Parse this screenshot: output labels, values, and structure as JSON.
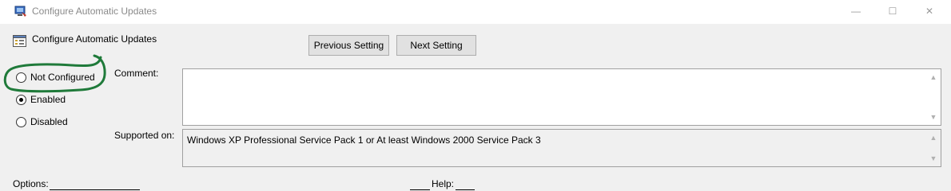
{
  "window": {
    "title": "Configure Automatic Updates",
    "minimize_icon": "minimize-icon",
    "maximize_icon": "maximize-icon",
    "close_icon": "close-icon",
    "min_glyph": "—",
    "max_glyph": "☐",
    "close_glyph": "✕"
  },
  "header": {
    "policy_title": "Configure Automatic Updates",
    "prev_label": "Previous Setting",
    "next_label": "Next Setting"
  },
  "state": {
    "options": [
      {
        "label": "Not Configured",
        "checked": false
      },
      {
        "label": "Enabled",
        "checked": true
      },
      {
        "label": "Disabled",
        "checked": false
      }
    ]
  },
  "comment": {
    "label": "Comment:",
    "value": ""
  },
  "supported": {
    "label": "Supported on:",
    "value": "Windows XP Professional Service Pack 1 or At least Windows 2000 Service Pack 3"
  },
  "bottom": {
    "options_label": "Options:",
    "help_label": "Help:"
  },
  "scroll": {
    "up_glyph": "▲",
    "down_glyph": "▼"
  },
  "colors": {
    "annotation": "#1f7a3a",
    "accent": "#0078d7"
  }
}
